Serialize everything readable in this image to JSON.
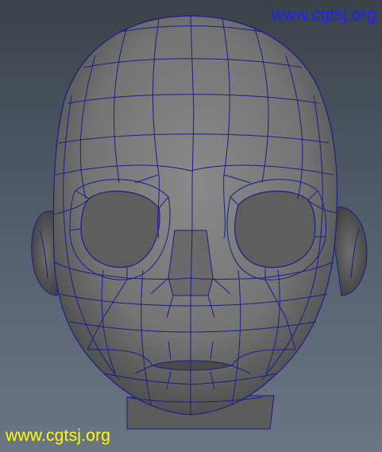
{
  "watermarks": {
    "top_text": "www.cgtsj.org",
    "bottom_text": "www.cgtsj.org"
  },
  "colors": {
    "top_watermark": "#1a22ff",
    "bottom_watermark": "#ffff00",
    "mesh_surface": "#7d7d7d",
    "wireframe": "#1d1d8a"
  }
}
